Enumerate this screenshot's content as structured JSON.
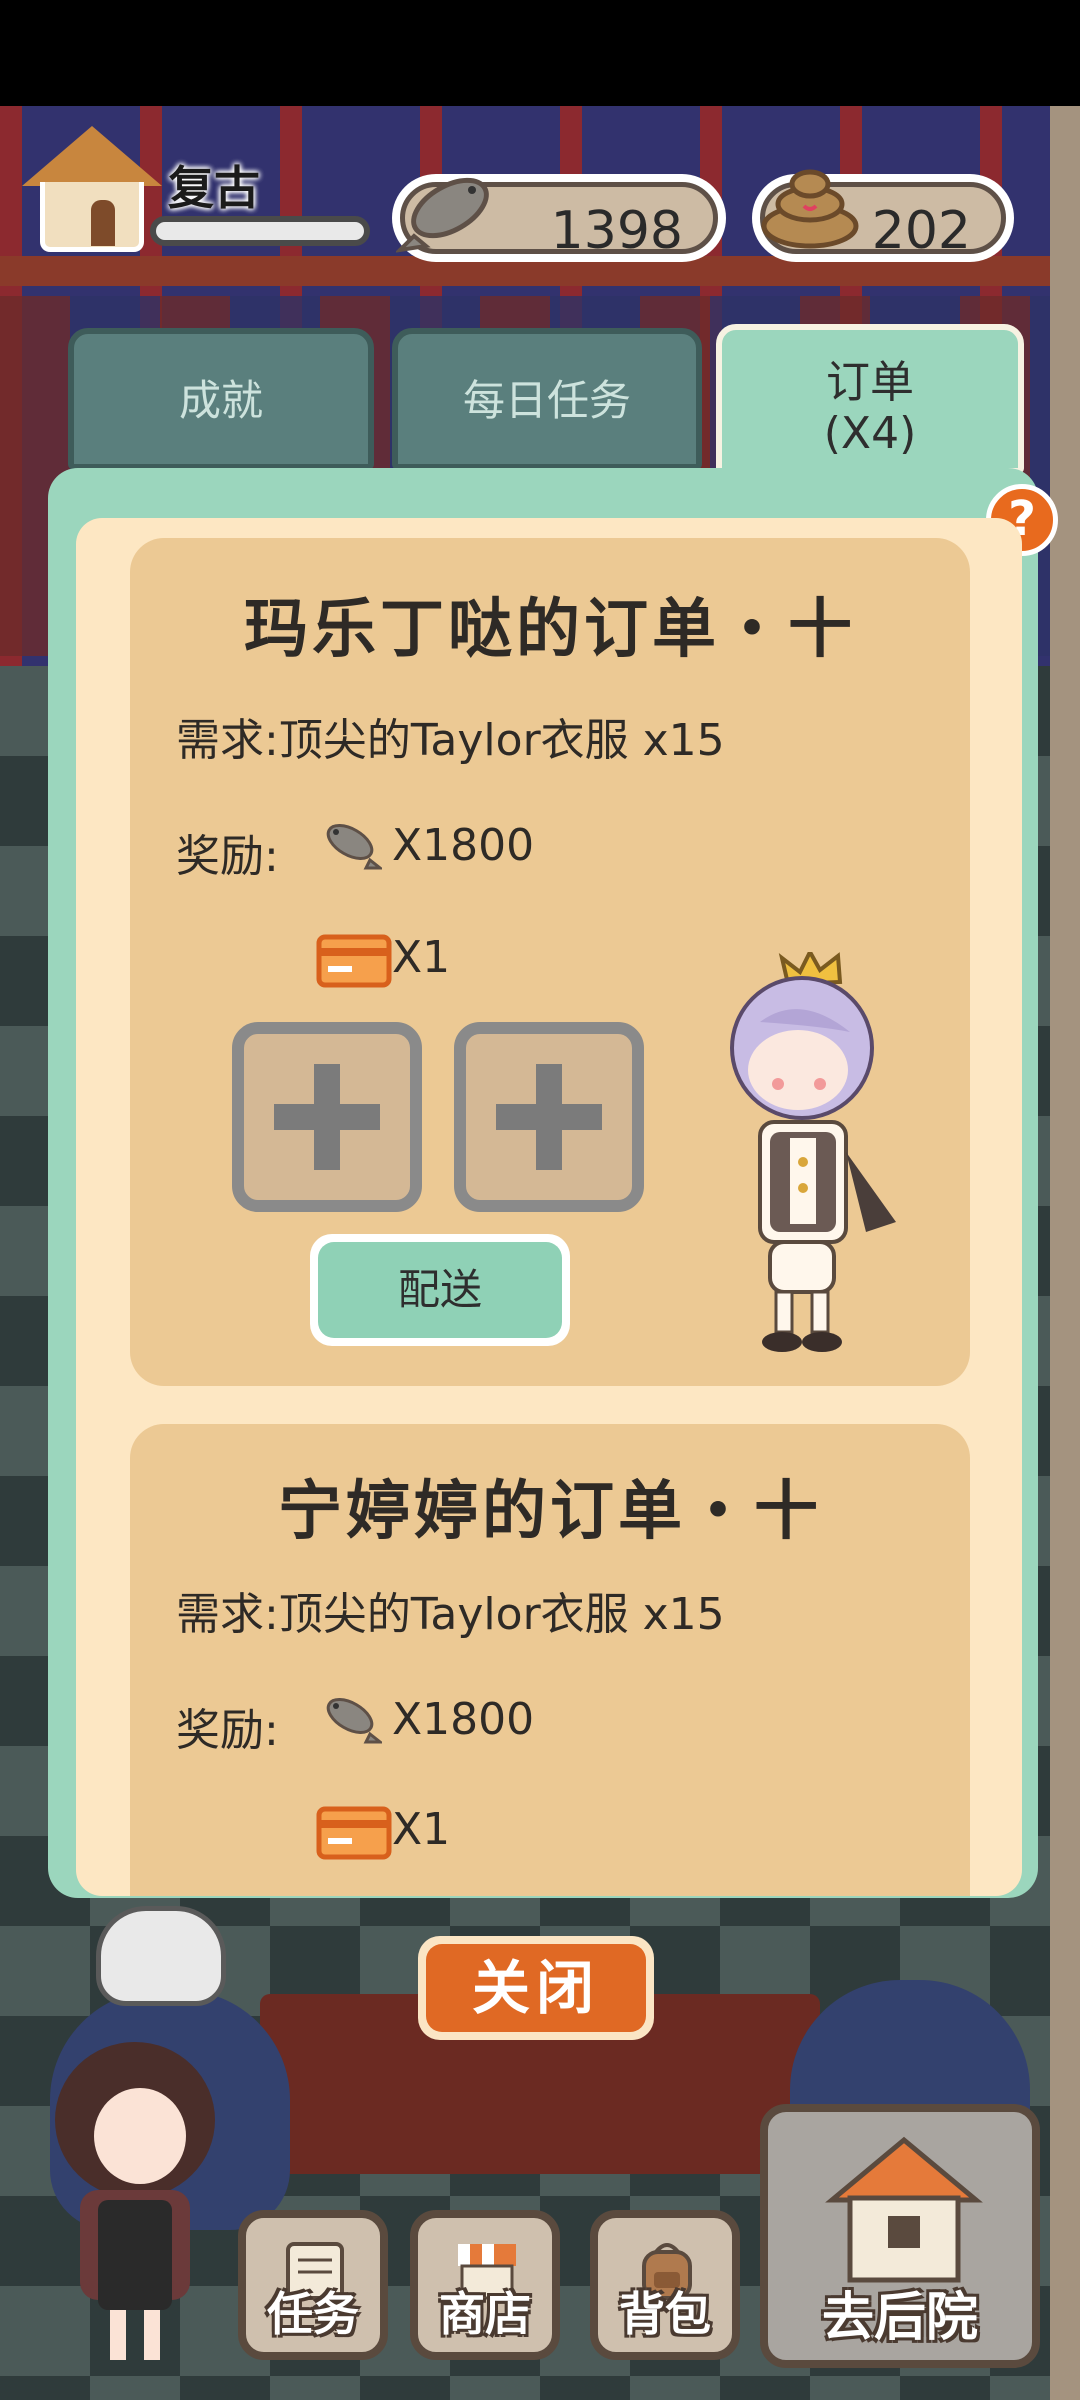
{
  "hud": {
    "location_name": "复古",
    "fish_count": "1398",
    "poop_count": "202"
  },
  "tabs": [
    {
      "label": "成就"
    },
    {
      "label": "每日任务"
    },
    {
      "label_line1": "订单",
      "label_line2": "(X4)"
    }
  ],
  "help_label": "?",
  "orders": [
    {
      "title": "玛乐丁哒的订单・十",
      "requirement": "需求:顶尖的Taylor衣服 x15",
      "reward_label": "奖励:",
      "reward_fish": "X1800",
      "reward_card": "X1",
      "deliver_label": "配送"
    },
    {
      "title": "宁婷婷的订单・十",
      "requirement": "需求:顶尖的Taylor衣服 x15",
      "reward_label": "奖励:",
      "reward_fish": "X1800",
      "reward_card": "X1"
    }
  ],
  "close_label": "关闭",
  "nav": {
    "task": "任务",
    "shop": "商店",
    "bag": "背包",
    "backyard": "去后院"
  },
  "colors": {
    "panel_green": "#9bd6bd",
    "card_tan": "#ecc994",
    "accent_orange": "#e06924",
    "tab_inactive": "#5a7f7d"
  }
}
